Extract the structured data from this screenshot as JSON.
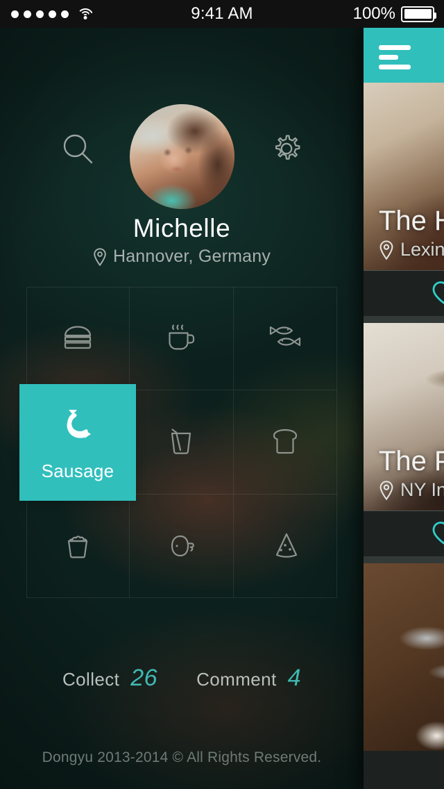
{
  "statusbar": {
    "signal_dots": 5,
    "wifi_icon": "wifi-icon",
    "time": "9:41 AM",
    "battery_percent": "100%",
    "battery_icon": "battery-full-icon"
  },
  "colors": {
    "accent_teal": "#31bfbc",
    "accent_teal_text": "#3fb9b2",
    "background_dark": "#0c1d19",
    "statusbar": "#111111"
  },
  "profile": {
    "search_icon": "search-icon",
    "settings_icon": "gear-icon",
    "avatar_alt": "avatar",
    "name": "Michelle",
    "location_icon": "location-pin-icon",
    "location": "Hannover, Germany"
  },
  "category_grid": {
    "columns": 3,
    "rows": 3,
    "selected_index": 3,
    "items": [
      {
        "label": "Burger",
        "icon": "burger-icon",
        "selected": false
      },
      {
        "label": "Coffee",
        "icon": "coffee-cup-icon",
        "selected": false
      },
      {
        "label": "Fish",
        "icon": "fish-icon",
        "selected": false
      },
      {
        "label": "Sausage",
        "icon": "sausage-icon",
        "selected": true
      },
      {
        "label": "Drink",
        "icon": "soda-cup-icon",
        "selected": false
      },
      {
        "label": "Bread",
        "icon": "bread-slice-icon",
        "selected": false
      },
      {
        "label": "Popcorn",
        "icon": "popcorn-icon",
        "selected": false
      },
      {
        "label": "Ham",
        "icon": "ham-leg-icon",
        "selected": false
      },
      {
        "label": "Pizza",
        "icon": "pizza-slice-icon",
        "selected": false
      }
    ]
  },
  "stats": [
    {
      "key": "Collect",
      "value": "26"
    },
    {
      "key": "Comment",
      "value": "4"
    }
  ],
  "footer": {
    "copyright": "Dongyu 2013-2014 © All Rights Reserved."
  },
  "feed": {
    "menu_icon": "hamburger-menu-icon",
    "cards": [
      {
        "title": "The H",
        "location_icon": "location-pin-icon",
        "location": "Lexing",
        "like_icon": "heart-outline-icon"
      },
      {
        "title": "The P",
        "location_icon": "location-pin-icon",
        "location": "NY Infi",
        "like_icon": "heart-outline-icon"
      },
      {
        "title": "",
        "location_icon": "location-pin-icon",
        "location": "",
        "like_icon": "heart-outline-icon"
      }
    ]
  }
}
